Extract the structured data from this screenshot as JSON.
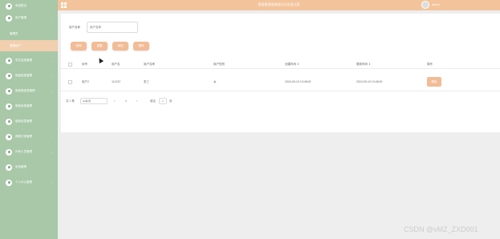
{
  "sidebar": {
    "items": [
      {
        "label": "系统首页",
        "icon": "home-icon"
      },
      {
        "label": "用户管理",
        "icon": "user-icon"
      },
      {
        "label": "管理员",
        "sub": true
      },
      {
        "label": "普通用户",
        "sub": true,
        "active": true
      },
      {
        "label": "学生信息管理",
        "icon": "folder-icon"
      },
      {
        "label": "班级信息管理",
        "icon": "folder-icon"
      },
      {
        "label": "宿舍楼信息管理",
        "icon": "folder-icon"
      },
      {
        "label": "宿舍信息管理",
        "icon": "folder-icon"
      },
      {
        "label": "缴费信息管理",
        "icon": "folder-icon"
      },
      {
        "label": "报修记录管理",
        "icon": "folder-icon"
      },
      {
        "label": "外来人员管理",
        "icon": "folder-icon"
      },
      {
        "label": "系统管理",
        "icon": "settings-icon"
      },
      {
        "label": "个人中心管理",
        "icon": "profile-icon"
      }
    ]
  },
  "header": {
    "title": "宿舍管理系统设计与实现之家",
    "username": "admin"
  },
  "search": {
    "label": "用户名称",
    "placeholder": "用户名称"
  },
  "toolbar": {
    "buttons": [
      "查询",
      "重置",
      "添加",
      "删除"
    ]
  },
  "table": {
    "columns": [
      "序号",
      "用户名",
      "用户名称",
      "用户性别",
      "创建时间 ⇕",
      "更新时间 ⇕",
      "操作"
    ],
    "rows": [
      {
        "index": "用户2",
        "username": "111222",
        "name": "张三",
        "gender": "女",
        "created": "2024-09-19 13:48:00",
        "updated": "2024-09-19 13:48:00",
        "action": "删除"
      }
    ]
  },
  "pagination": {
    "total": "共 1 条",
    "page_size": "10条/页",
    "prev": "‹",
    "page": "1",
    "next": "›",
    "goto_label": "前往",
    "goto_value": "1",
    "goto_suffix": "页"
  },
  "watermark": "CSDN @vMZ_ZXD001",
  "colors": {
    "sidebar": "#a8c8a8",
    "header": "#f3c49c",
    "button": "#f1bc96",
    "active_item": "#f2cfae"
  }
}
